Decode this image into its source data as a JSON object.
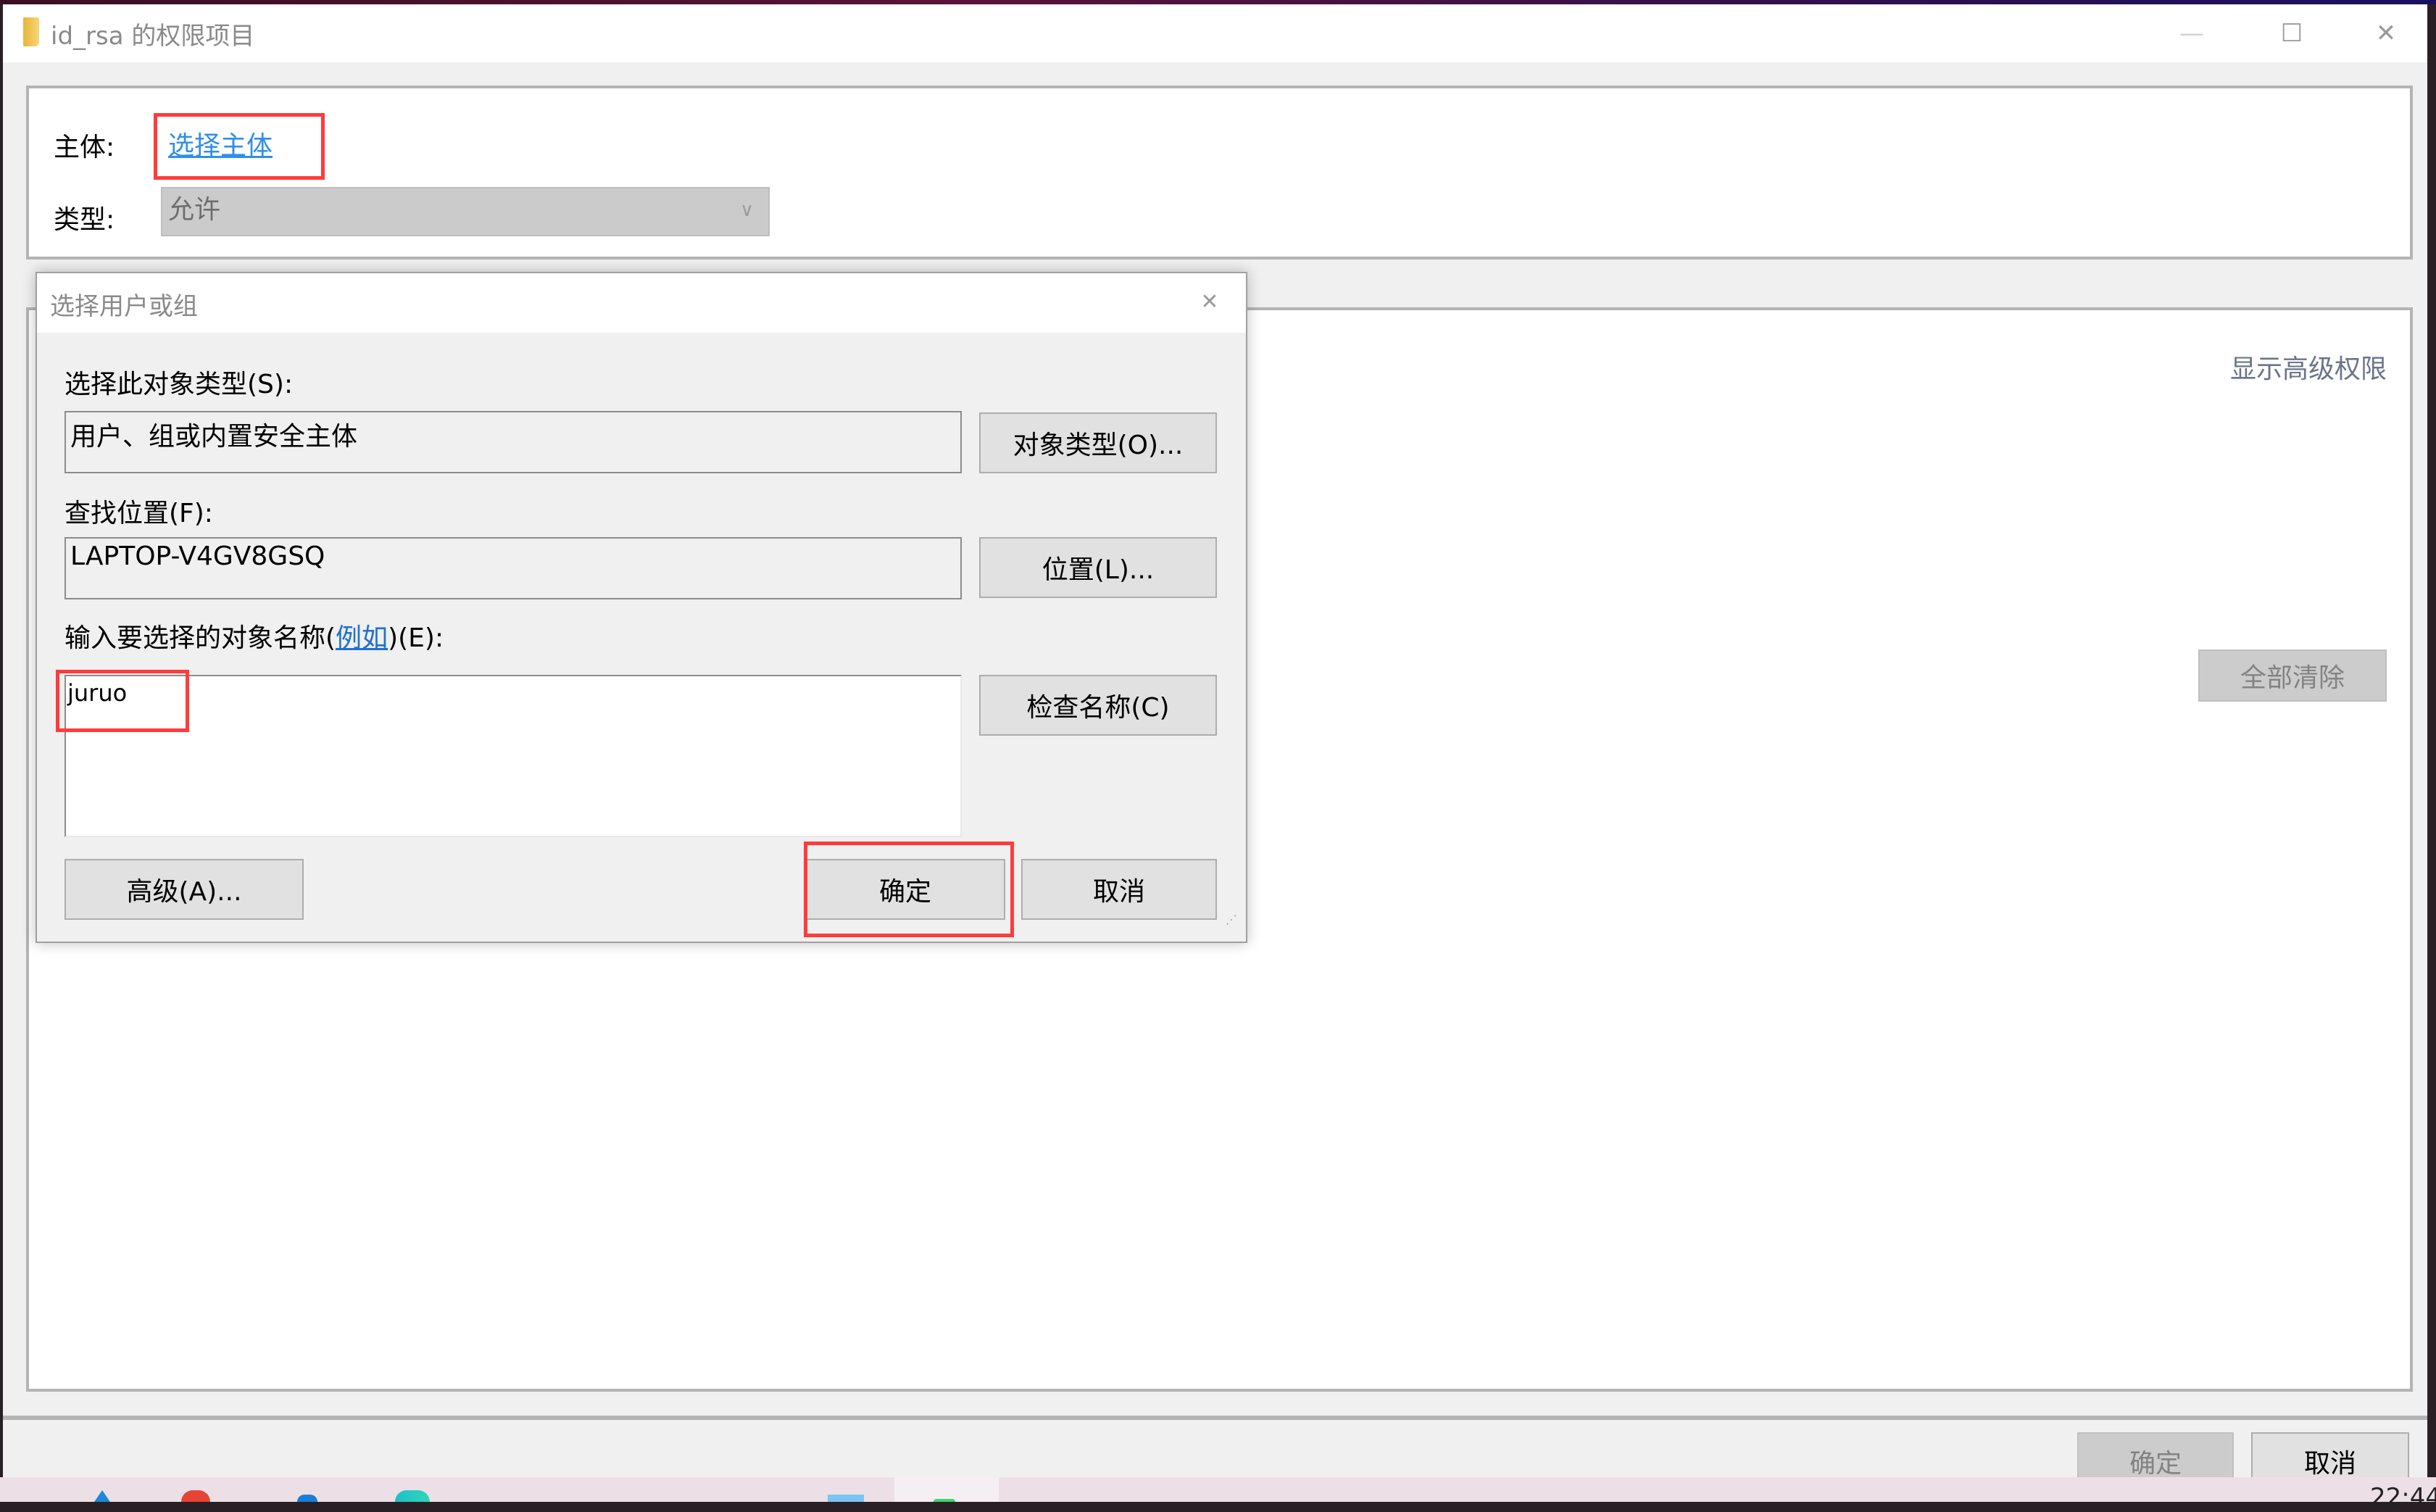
{
  "window": {
    "title": "id_rsa 的权限项目",
    "controls": {
      "minimize": "—",
      "maximize": "☐",
      "close": "✕"
    },
    "principal_label": "主体:",
    "principal_link": "选择主体",
    "type_label": "类型:",
    "type_value": "允许",
    "show_advanced_link": "显示高级权限",
    "clear_all_button": "全部清除",
    "ok_button": "确定",
    "cancel_button": "取消"
  },
  "dialog": {
    "title": "选择用户或组",
    "close": "✕",
    "object_type_label": "选择此对象类型(S):",
    "object_type_value": "用户、组或内置安全主体",
    "object_types_button": "对象类型(O)...",
    "location_label": "查找位置(F):",
    "location_value": "LAPTOP-V4GV8GSQ",
    "locations_button": "位置(L)...",
    "names_label_prefix": "输入要选择的对象名称(",
    "names_label_link": "例如",
    "names_label_suffix": ")(E):",
    "names_value": "juruo",
    "check_names_button": "检查名称(C)",
    "advanced_button": "高级(A)...",
    "ok_button": "确定",
    "cancel_button": "取消"
  },
  "taskbar": {
    "clock_partial": "22:44"
  },
  "colors": {
    "highlight_box": "#ff3b3b",
    "link": "#2f8fe8"
  }
}
